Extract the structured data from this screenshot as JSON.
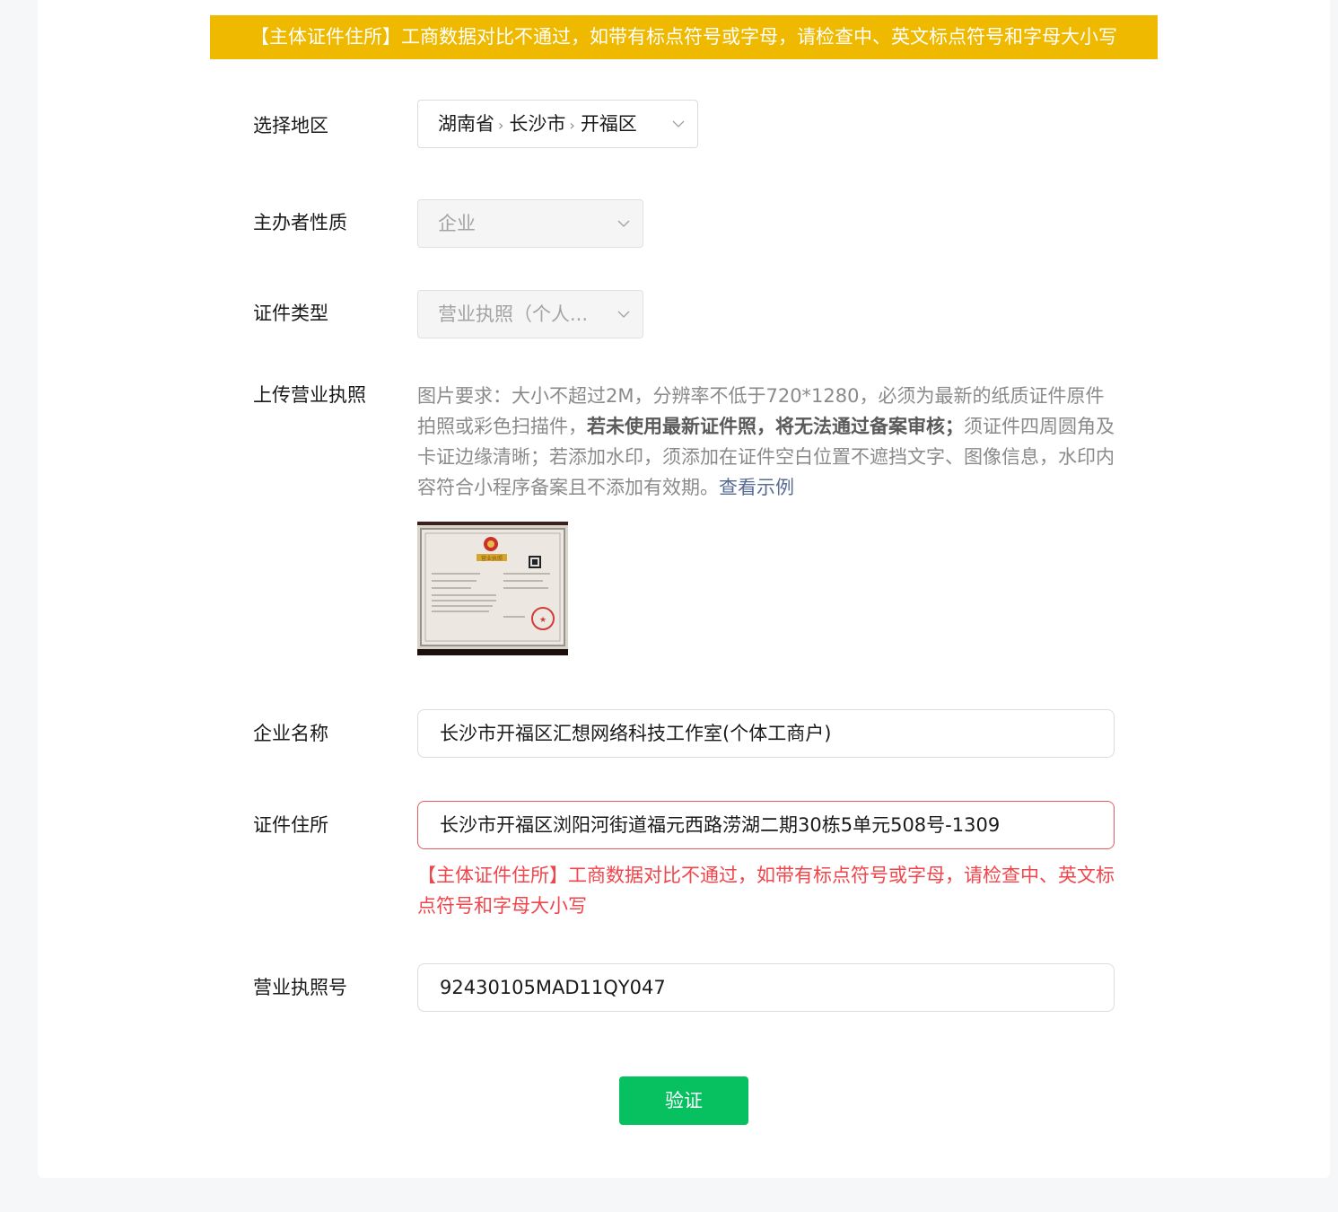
{
  "banner": "【主体证件住所】工商数据对比不通过，如带有标点符号或字母，请检查中、英文标点符号和字母大小写",
  "fields": {
    "region": {
      "label": "选择地区",
      "province": "湖南省",
      "city": "长沙市",
      "district": "开福区"
    },
    "organizer_type": {
      "label": "主办者性质",
      "value": "企业"
    },
    "cert_type": {
      "label": "证件类型",
      "value": "营业执照（个人..."
    },
    "upload": {
      "label": "上传营业执照",
      "hint_part1": "图片要求：大小不超过2M，分辨率不低于720*1280，必须为最新的纸质证件原件拍照或彩色扫描件，",
      "hint_bold": "若未使用最新证件照，将无法通过备案审核；",
      "hint_part2": "须证件四周圆角及卡证边缘清晰；若添加水印，须添加在证件空白位置不遮挡文字、图像信息，水印内容符合小程序备案且不添加有效期。",
      "example_link": "查看示例",
      "license_title": "营业执照"
    },
    "company_name": {
      "label": "企业名称",
      "value": "长沙市开福区汇想网络科技工作室(个体工商户)"
    },
    "address": {
      "label": "证件住所",
      "value": "长沙市开福区浏阳河街道福元西路涝湖二期30栋5单元508号-1309",
      "error": "【主体证件住所】工商数据对比不通过，如带有标点符号或字母，请检查中、英文标点符号和字母大小写"
    },
    "license_no": {
      "label": "营业执照号",
      "value": "92430105MAD11QY047"
    }
  },
  "submit_label": "验证",
  "colors": {
    "banner_bg": "#efb900",
    "error": "#f0454b",
    "primary": "#07c160",
    "link": "#576b95"
  }
}
